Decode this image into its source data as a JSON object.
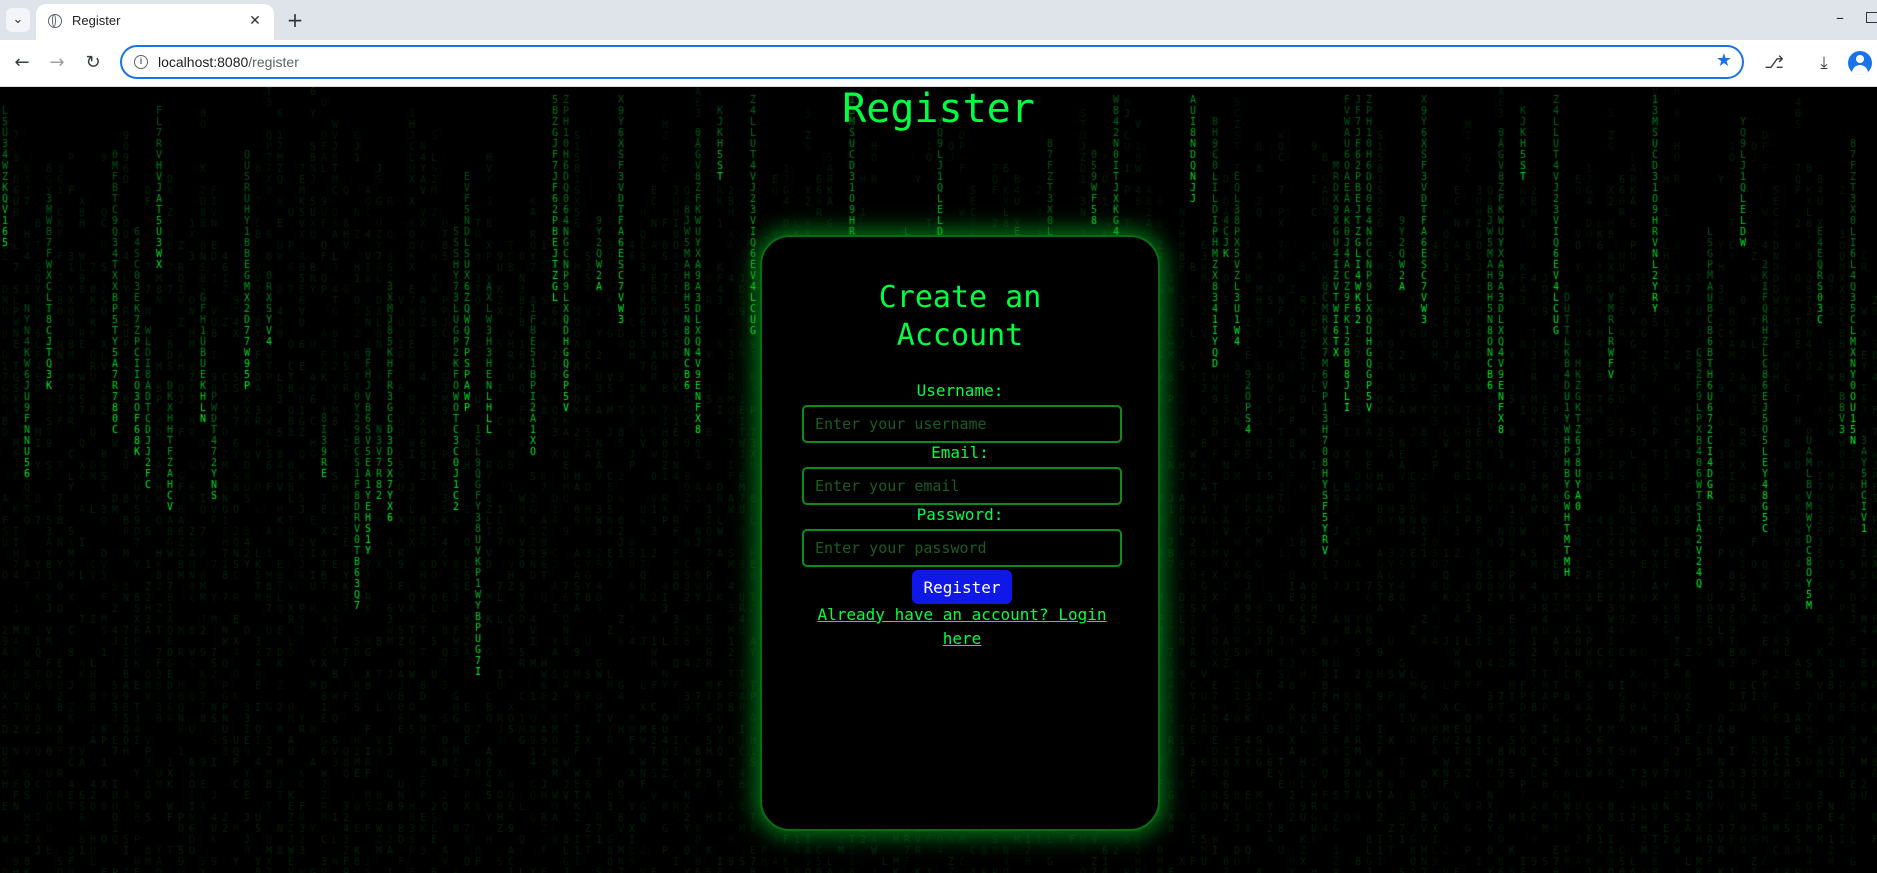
{
  "browser": {
    "tab_title": "Register",
    "url_host": "localhost:8080",
    "url_path": "/register",
    "accent_color": "#1a73e8"
  },
  "page": {
    "heading": "Register",
    "card_title": "Create an\nAccount",
    "username_label": "Username:",
    "username_placeholder": "Enter your username",
    "email_label": "Email:",
    "email_placeholder": "Enter your email",
    "password_label": "Password:",
    "password_placeholder": "Enter your password",
    "register_button": "Register",
    "login_link": "Already have an account? Login here",
    "colors": {
      "matrix_green": "#00ff41",
      "button_blue": "#0f18e8",
      "background": "#000000"
    }
  }
}
